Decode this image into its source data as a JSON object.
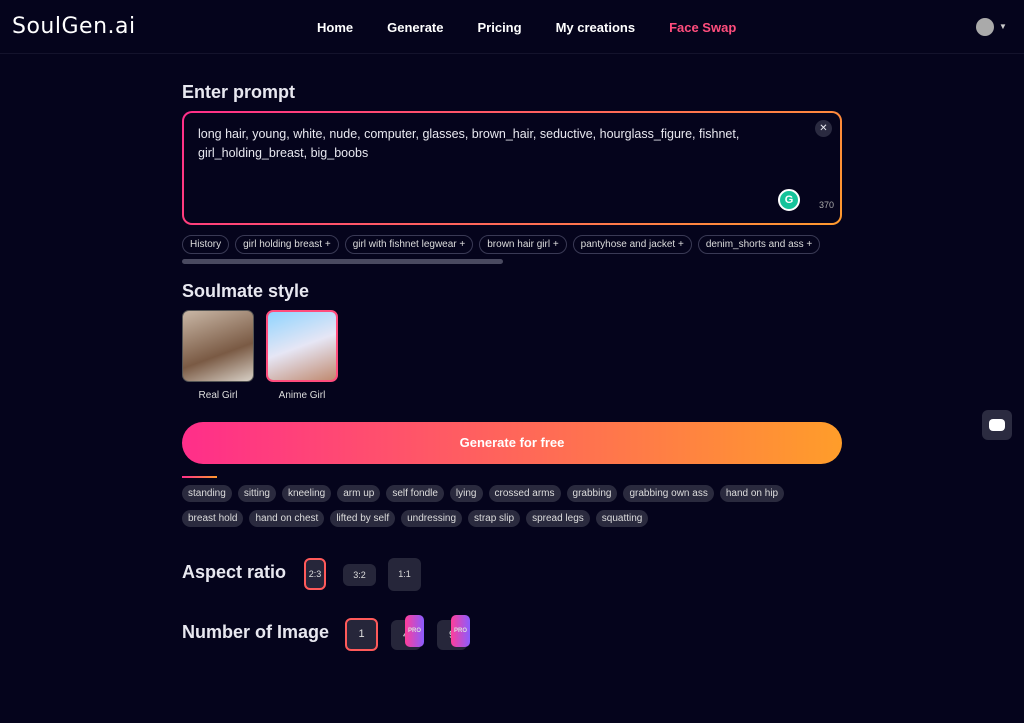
{
  "nav": {
    "logo": "SoulGen.ai",
    "links": [
      "Home",
      "Generate",
      "Pricing",
      "My creations",
      "Face Swap"
    ],
    "active": "Face Swap"
  },
  "prompt": {
    "title": "Enter prompt",
    "value": "long hair, young, white, nude, computer, glasses, brown_hair, seductive, hourglass_figure, fishnet, girl_holding_breast, big_boobs",
    "count": "370"
  },
  "history": {
    "label": "History",
    "items": [
      "girl holding breast +",
      "girl with fishnet legwear +",
      "brown hair girl +",
      "pantyhose and jacket +",
      "denim_shorts and ass +"
    ]
  },
  "style": {
    "title": "Soulmate style",
    "options": [
      "Real Girl",
      "Anime Girl"
    ],
    "selected": "Anime Girl"
  },
  "generate_label": "Generate for free",
  "poses": [
    "standing",
    "sitting",
    "kneeling",
    "arm up",
    "self fondle",
    "lying",
    "crossed arms",
    "grabbing",
    "grabbing own ass",
    "hand on hip",
    "breast hold",
    "hand on chest",
    "lifted by self",
    "undressing",
    "strap slip",
    "spread legs",
    "squatting"
  ],
  "aspect": {
    "title": "Aspect ratio",
    "options": [
      "2:3",
      "3:2",
      "1:1"
    ],
    "selected": "2:3"
  },
  "number": {
    "title": "Number of Image",
    "options": [
      "1",
      "4",
      "9"
    ],
    "selected": "1",
    "pro_badge": "PRO"
  }
}
